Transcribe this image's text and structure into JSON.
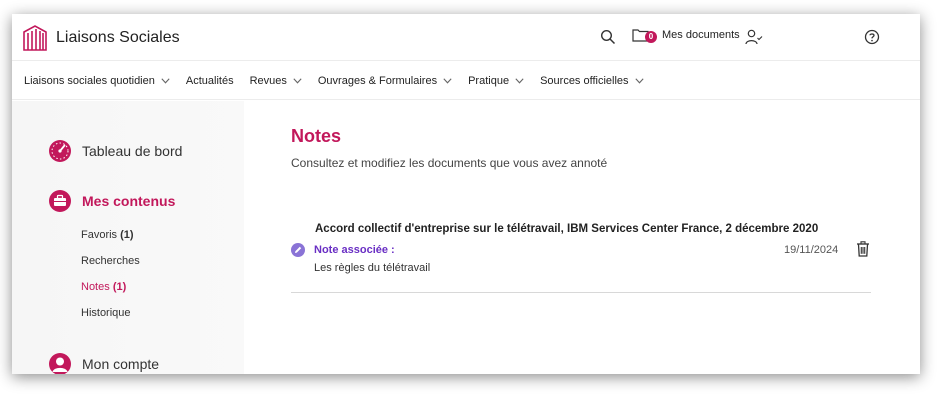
{
  "header": {
    "brand_name": "Liaisons Sociales",
    "docs_label": "Mes documents",
    "docs_count": "0"
  },
  "nav": {
    "items": [
      {
        "label": "Liaisons sociales quotidien",
        "has_menu": true
      },
      {
        "label": "Actualités",
        "has_menu": false
      },
      {
        "label": "Revues",
        "has_menu": true
      },
      {
        "label": "Ouvrages & Formulaires",
        "has_menu": true
      },
      {
        "label": "Pratique",
        "has_menu": true
      },
      {
        "label": "Sources officielles",
        "has_menu": true
      }
    ]
  },
  "sidebar": {
    "dashboard": {
      "label": "Tableau de bord",
      "icon": "gauge-icon"
    },
    "contents": {
      "label": "Mes contenus",
      "icon": "briefcase-icon",
      "items": [
        {
          "label": "Favoris",
          "count": "(1)"
        },
        {
          "label": "Recherches",
          "count": ""
        },
        {
          "label": "Notes",
          "count": "(1)"
        },
        {
          "label": "Historique",
          "count": ""
        }
      ]
    },
    "account": {
      "label": "Mon compte",
      "icon": "user-avatar-icon"
    }
  },
  "main": {
    "title": "Notes",
    "subtitle": "Consultez et modifiez les documents que vous avez annoté",
    "notes": [
      {
        "doc_title": "Accord collectif d'entreprise sur le télétravail, IBM Services Center France, 2 décembre 2020",
        "note_label": "Note associée :",
        "note_text": "Les règles du télétravail",
        "date": "19/11/2024"
      }
    ]
  },
  "colors": {
    "accent": "#c2185b",
    "note_label": "#6a2fc4",
    "pencil": "#8a73d6"
  }
}
